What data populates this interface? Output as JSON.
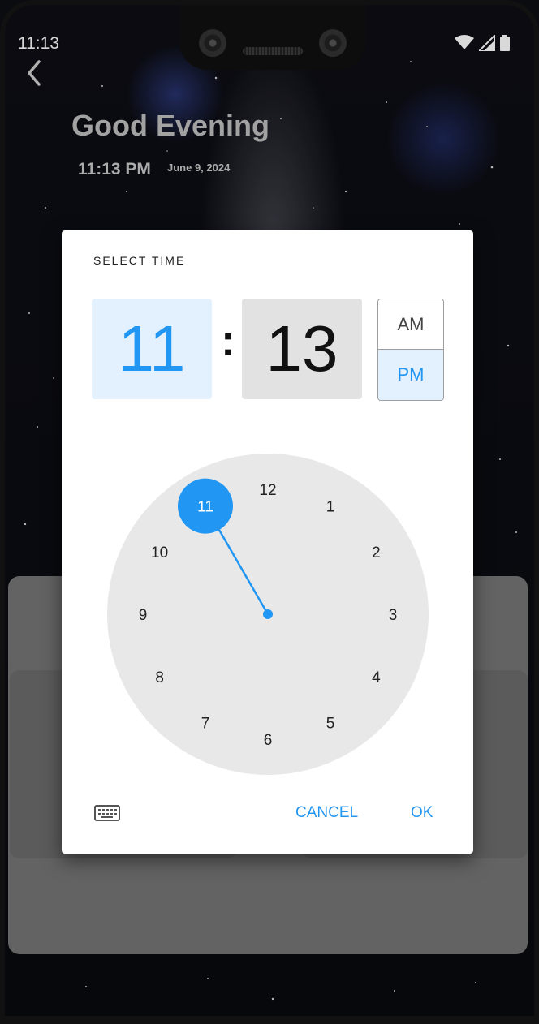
{
  "status_bar": {
    "time": "11:13",
    "icons": [
      "wifi-icon",
      "cellular-icon",
      "battery-icon"
    ]
  },
  "header": {
    "greeting": "Good Evening",
    "time": "11:13 PM",
    "date": "June 9, 2024"
  },
  "dialog": {
    "title": "SELECT TIME",
    "hour": "11",
    "separator": ":",
    "minute": "13",
    "am_label": "AM",
    "pm_label": "PM",
    "selected_period": "PM",
    "dial_numbers": [
      "12",
      "1",
      "2",
      "3",
      "4",
      "5",
      "6",
      "7",
      "8",
      "9",
      "10",
      "11"
    ],
    "selected_hour": 11,
    "cancel_label": "CANCEL",
    "ok_label": "OK"
  },
  "colors": {
    "accent": "#2196f3",
    "accent_light": "#e3f0fd",
    "dial_face": "#e8e8e8"
  }
}
